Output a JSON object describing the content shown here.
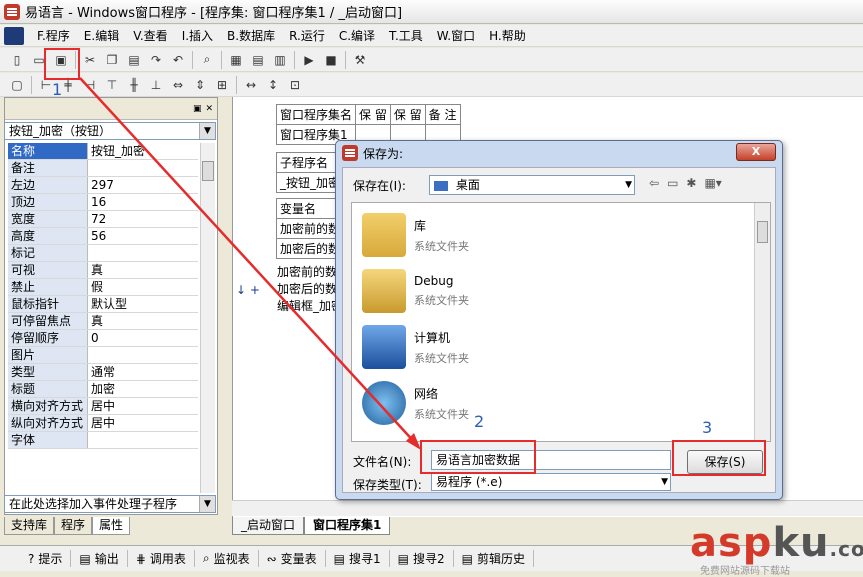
{
  "window": {
    "title": "易语言 - Windows窗口程序 - [程序集: 窗口程序集1 / _启动窗口]"
  },
  "menu": [
    "F.程序",
    "E.编辑",
    "V.查看",
    "I.插入",
    "B.数据库",
    "R.运行",
    "C.编译",
    "T.工具",
    "W.窗口",
    "H.帮助"
  ],
  "left_panel": {
    "component": "按钮_加密（按钮）",
    "properties": [
      {
        "name": "名称",
        "value": "按钮_加密"
      },
      {
        "name": "备注",
        "value": ""
      },
      {
        "name": "左边",
        "value": "297"
      },
      {
        "name": "顶边",
        "value": "16"
      },
      {
        "name": "宽度",
        "value": "72"
      },
      {
        "name": "高度",
        "value": "56"
      },
      {
        "name": "标记",
        "value": ""
      },
      {
        "name": "可视",
        "value": "真"
      },
      {
        "name": "禁止",
        "value": "假"
      },
      {
        "name": "鼠标指针",
        "value": "默认型"
      },
      {
        "name": "可停留焦点",
        "value": "真"
      },
      {
        "name": "停留顺序",
        "value": "0"
      },
      {
        "name": "图片",
        "value": ""
      },
      {
        "name": "类型",
        "value": "通常"
      },
      {
        "name": "标题",
        "value": "加密"
      },
      {
        "name": "横向对齐方式",
        "value": "居中"
      },
      {
        "name": "纵向对齐方式",
        "value": "居中"
      },
      {
        "name": "字体",
        "value": ""
      }
    ],
    "event_combo": "在此处选择加入事件处理子程序",
    "tabs": [
      "支持库",
      "程序",
      "属性"
    ]
  },
  "editor": {
    "assembly_header": [
      "窗口程序集名",
      "保 留",
      "保 留",
      "备 注"
    ],
    "assembly_name": "窗口程序集1",
    "sub_header": "子程序名",
    "sub_name": "_按钮_加密",
    "var_header": "变量名",
    "vars": [
      "加密前的数",
      "加密后的数"
    ],
    "code_lines": [
      "加密前的数",
      "加密后的数",
      "编辑框_加密"
    ],
    "tabs": [
      "_启动窗口",
      "窗口程序集1"
    ]
  },
  "bottom_tabs": [
    "提示",
    "输出",
    "调用表",
    "监视表",
    "变量表",
    "搜寻1",
    "搜寻2",
    "剪辑历史"
  ],
  "dialog": {
    "title": "保存为:",
    "save_in_label": "保存在(I):",
    "save_in_value": "桌面",
    "items": [
      {
        "name": "库",
        "desc": "系统文件夹"
      },
      {
        "name": "Debug",
        "desc": "系统文件夹"
      },
      {
        "name": "计算机",
        "desc": "系统文件夹"
      },
      {
        "name": "网络",
        "desc": "系统文件夹"
      }
    ],
    "filename_label": "文件名(N):",
    "filename_value": "易语言加密数据",
    "filetype_label": "保存类型(T):",
    "filetype_value": "易程序 (*.e)",
    "save_button": "保存(S)",
    "close": "X"
  },
  "annotations": [
    "1",
    "2",
    "3"
  ],
  "watermark": {
    "main": "asp",
    "ku": "ku",
    "tld": ".com",
    "sub": "免费网站源码下载站"
  }
}
